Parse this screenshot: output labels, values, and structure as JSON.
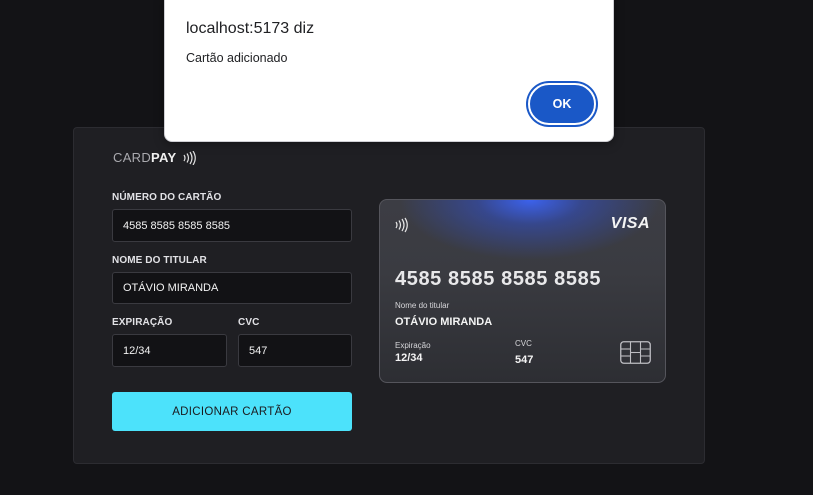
{
  "dialog": {
    "title": "localhost:5173 diz",
    "message": "Cartão adicionado",
    "ok_label": "OK"
  },
  "brand": {
    "light": "CARD",
    "bold": "PAY",
    "icon": "contactless-icon"
  },
  "form": {
    "number_label": "NÚMERO DO CARTÃO",
    "number_value": "4585 8585 8585 8585",
    "holder_label": "NOME DO TITULAR",
    "holder_value": "OTÁVIO MIRANDA",
    "expiry_label": "EXPIRAÇÃO",
    "expiry_value": "12/34",
    "cvc_label": "CVC",
    "cvc_value": "547",
    "submit_label": "ADICIONAR CARTÃO"
  },
  "card_preview": {
    "brand": "VISA",
    "number": "4585 8585 8585 8585",
    "holder_caption": "Nome do titular",
    "holder": "OTÁVIO MIRANDA",
    "expiry_caption": "Expiração",
    "expiry": "12/34",
    "cvc_caption": "CVC",
    "cvc": "547",
    "icons": [
      "contactless-icon",
      "chip-icon"
    ]
  },
  "colors": {
    "page_bg": "#131316",
    "panel_bg": "#1f1f23",
    "accent": "#4ce2fb",
    "dialog_button": "#1a58c7"
  }
}
